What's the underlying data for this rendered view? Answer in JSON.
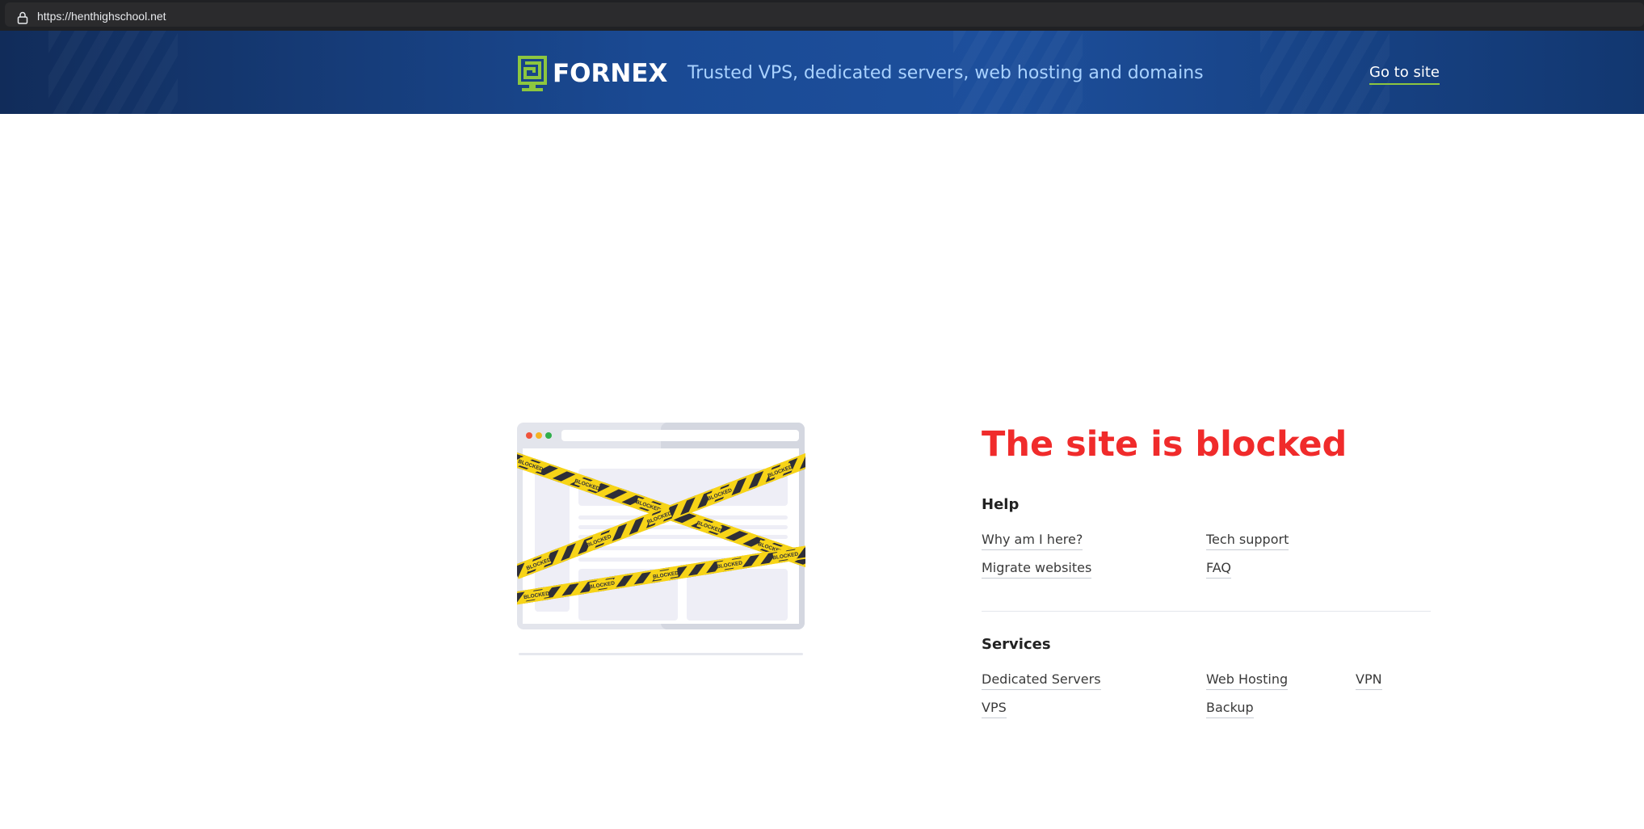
{
  "browser": {
    "url": "https://henthighschool.net",
    "lock_icon": "lock-icon"
  },
  "header": {
    "logo_text": "FORNEX",
    "tagline": "Trusted VPS, dedicated servers, web hosting and domains",
    "go_to_site_label": "Go to site",
    "logo_color": "#8dc63f"
  },
  "main": {
    "title": "The site is blocked",
    "title_color": "#f02b2b",
    "illustration": {
      "tape_text": "BLOCKED"
    },
    "help": {
      "heading": "Help",
      "links": [
        "Why am I here?",
        "Tech support",
        "Migrate websites",
        "FAQ"
      ]
    },
    "services": {
      "heading": "Services",
      "links": [
        "Dedicated Servers",
        "Web Hosting",
        "VPN",
        "VPS",
        "Backup"
      ]
    }
  }
}
